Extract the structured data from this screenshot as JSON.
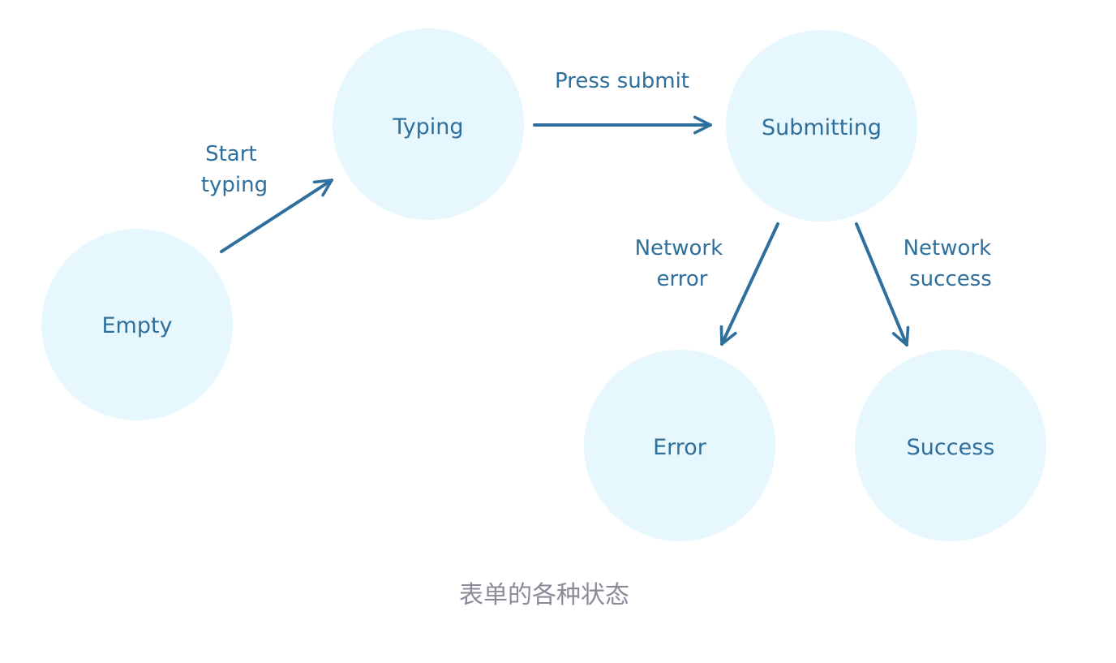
{
  "diagram": {
    "nodes": {
      "empty": "Empty",
      "typing": "Typing",
      "submitting": "Submitting",
      "error": "Error",
      "success": "Success"
    },
    "edges": {
      "start_typing": [
        "Start",
        "typing"
      ],
      "press_submit": "Press submit",
      "network_error": [
        "Network",
        "error"
      ],
      "network_success": [
        "Network",
        "success"
      ]
    },
    "colors": {
      "node_fill": "#e6f7fd",
      "accent": "#2f6f9c",
      "caption": "#8a8a99"
    }
  },
  "caption": "表单的各种状态"
}
